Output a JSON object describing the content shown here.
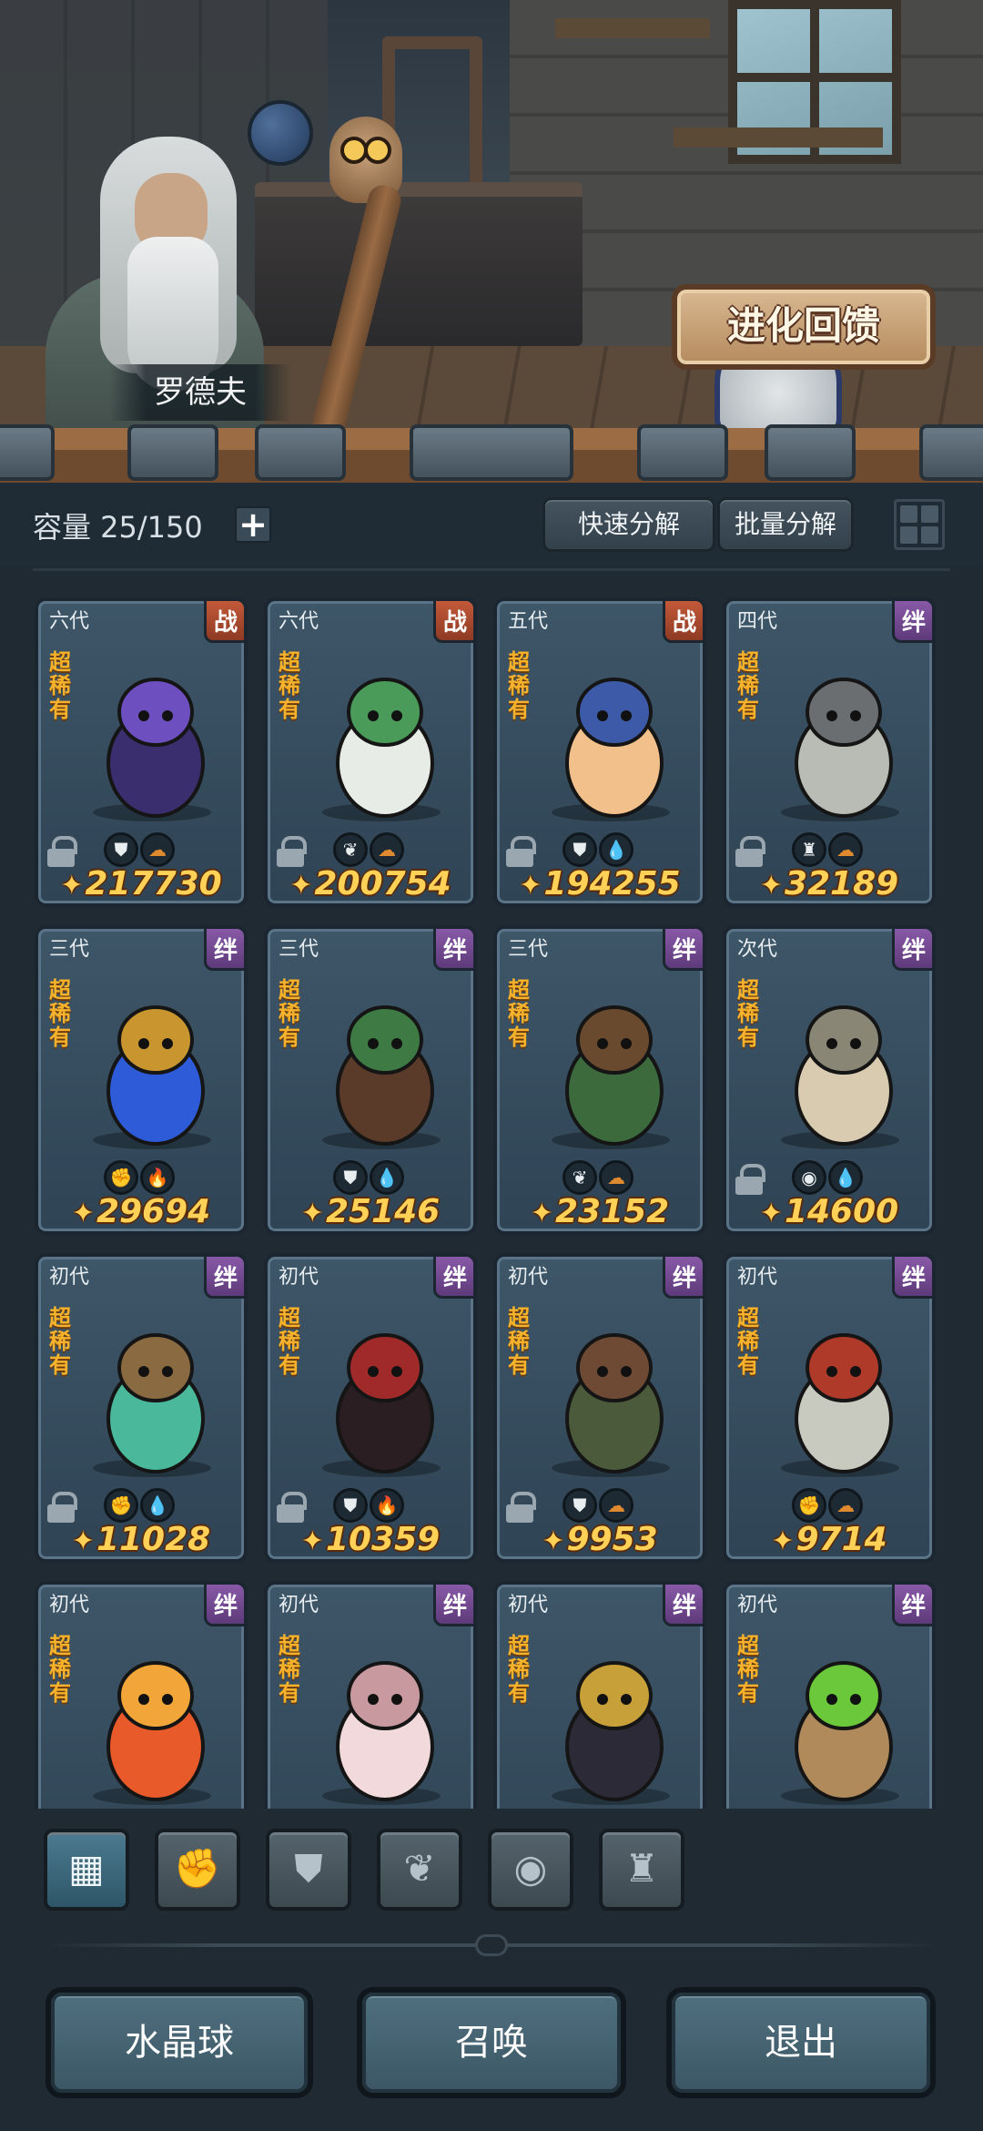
{
  "npc": {
    "name": "罗德夫"
  },
  "evolution_button": {
    "label": "进化回馈"
  },
  "inventory": {
    "capacity_label": "容量 25/150",
    "add_icon": "plus-icon",
    "quick_decompose": "快速分解",
    "batch_decompose": "批量分解",
    "view_toggle_icon": "grid-view-icon"
  },
  "cards": [
    {
      "gen": "六代",
      "tag": "战",
      "rarity": "超稀有",
      "power": "217730",
      "locked": true,
      "faction_icon": "shield-icon",
      "element_icon": "earth-icon"
    },
    {
      "gen": "六代",
      "tag": "战",
      "rarity": "超稀有",
      "power": "200754",
      "locked": true,
      "faction_icon": "sprout-icon",
      "element_icon": "earth-icon"
    },
    {
      "gen": "五代",
      "tag": "战",
      "rarity": "超稀有",
      "power": "194255",
      "locked": true,
      "faction_icon": "shield-icon",
      "element_icon": "water-icon"
    },
    {
      "gen": "四代",
      "tag": "绊",
      "rarity": "超稀有",
      "power": "32189",
      "locked": true,
      "faction_icon": "tower-icon",
      "element_icon": "earth-icon"
    },
    {
      "gen": "三代",
      "tag": "绊",
      "rarity": "超稀有",
      "power": "29694",
      "locked": false,
      "faction_icon": "fist-icon",
      "element_icon": "fire-icon"
    },
    {
      "gen": "三代",
      "tag": "绊",
      "rarity": "超稀有",
      "power": "25146",
      "locked": false,
      "faction_icon": "shield-icon",
      "element_icon": "water-icon"
    },
    {
      "gen": "三代",
      "tag": "绊",
      "rarity": "超稀有",
      "power": "23152",
      "locked": false,
      "faction_icon": "sprout-icon",
      "element_icon": "earth-icon"
    },
    {
      "gen": "次代",
      "tag": "绊",
      "rarity": "超稀有",
      "power": "14600",
      "locked": true,
      "faction_icon": "alien-icon",
      "element_icon": "water-icon"
    },
    {
      "gen": "初代",
      "tag": "绊",
      "rarity": "超稀有",
      "power": "11028",
      "locked": true,
      "faction_icon": "fist-icon",
      "element_icon": "water-icon"
    },
    {
      "gen": "初代",
      "tag": "绊",
      "rarity": "超稀有",
      "power": "10359",
      "locked": true,
      "faction_icon": "shield-icon",
      "element_icon": "fire-icon"
    },
    {
      "gen": "初代",
      "tag": "绊",
      "rarity": "超稀有",
      "power": "9953",
      "locked": true,
      "faction_icon": "shield-icon",
      "element_icon": "earth-icon"
    },
    {
      "gen": "初代",
      "tag": "绊",
      "rarity": "超稀有",
      "power": "9714",
      "locked": false,
      "faction_icon": "fist-icon",
      "element_icon": "earth-icon"
    },
    {
      "gen": "初代",
      "tag": "绊",
      "rarity": "超稀有",
      "power": "",
      "locked": false,
      "faction_icon": "",
      "element_icon": ""
    },
    {
      "gen": "初代",
      "tag": "绊",
      "rarity": "超稀有",
      "power": "",
      "locked": false,
      "faction_icon": "",
      "element_icon": ""
    },
    {
      "gen": "初代",
      "tag": "绊",
      "rarity": "超稀有",
      "power": "",
      "locked": false,
      "faction_icon": "",
      "element_icon": ""
    },
    {
      "gen": "初代",
      "tag": "绊",
      "rarity": "超稀有",
      "power": "",
      "locked": false,
      "faction_icon": "",
      "element_icon": ""
    }
  ],
  "filters": [
    {
      "icon": "all-blocks-icon",
      "active": true
    },
    {
      "icon": "fist-icon",
      "active": false
    },
    {
      "icon": "shield-icon",
      "active": false
    },
    {
      "icon": "sprout-icon",
      "active": false
    },
    {
      "icon": "alien-icon",
      "active": false
    },
    {
      "icon": "tower-icon",
      "active": false
    }
  ],
  "actions": {
    "crystal_ball": "水晶球",
    "summon": "召唤",
    "exit": "退出"
  },
  "colors": {
    "power_text": "#ffd257",
    "rarity_text": "#f6b22a",
    "tag_zhan": "#c45a3a",
    "tag_ban": "#8a5aa8",
    "card_bg": "#2f4455"
  }
}
